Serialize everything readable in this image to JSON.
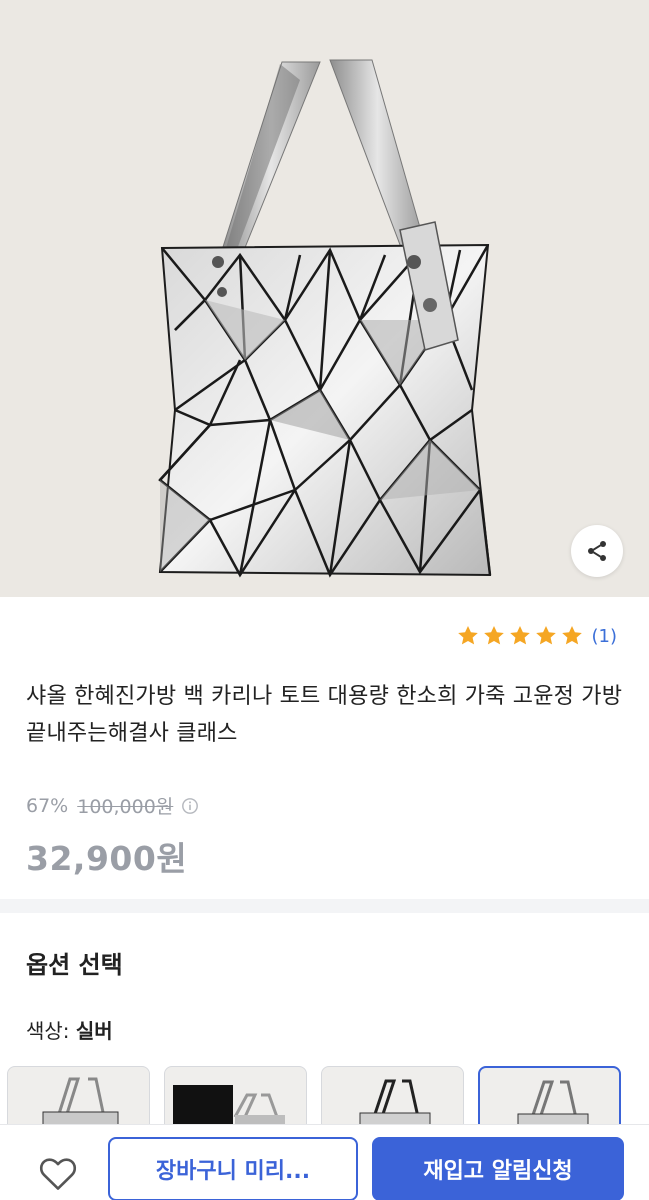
{
  "product": {
    "image_alt_icon": "silver-geometric-tote-bag",
    "rating_stars": 5,
    "review_count": "(1)",
    "title": "샤올 한혜진가방 백 카리나 토트 대용량 한소희 가죽 고윤정 가방 끝내주는해결사 클래스",
    "discount_rate": "67%",
    "original_price": "100,000원",
    "final_price": "32,900원"
  },
  "options": {
    "section_title": "옵션 선택",
    "color_label": "색상: ",
    "color_value": "실버",
    "swatches": [
      "silver-tote",
      "black-tote",
      "silver-tote-alt",
      "silver-tote-selected"
    ]
  },
  "actions": {
    "cart_label": "장바구니 미리...",
    "restock_label": "재입고 알림신청"
  },
  "colors": {
    "accent": "#3b63d8",
    "star": "#f5a623",
    "muted": "#9a9ea6"
  }
}
